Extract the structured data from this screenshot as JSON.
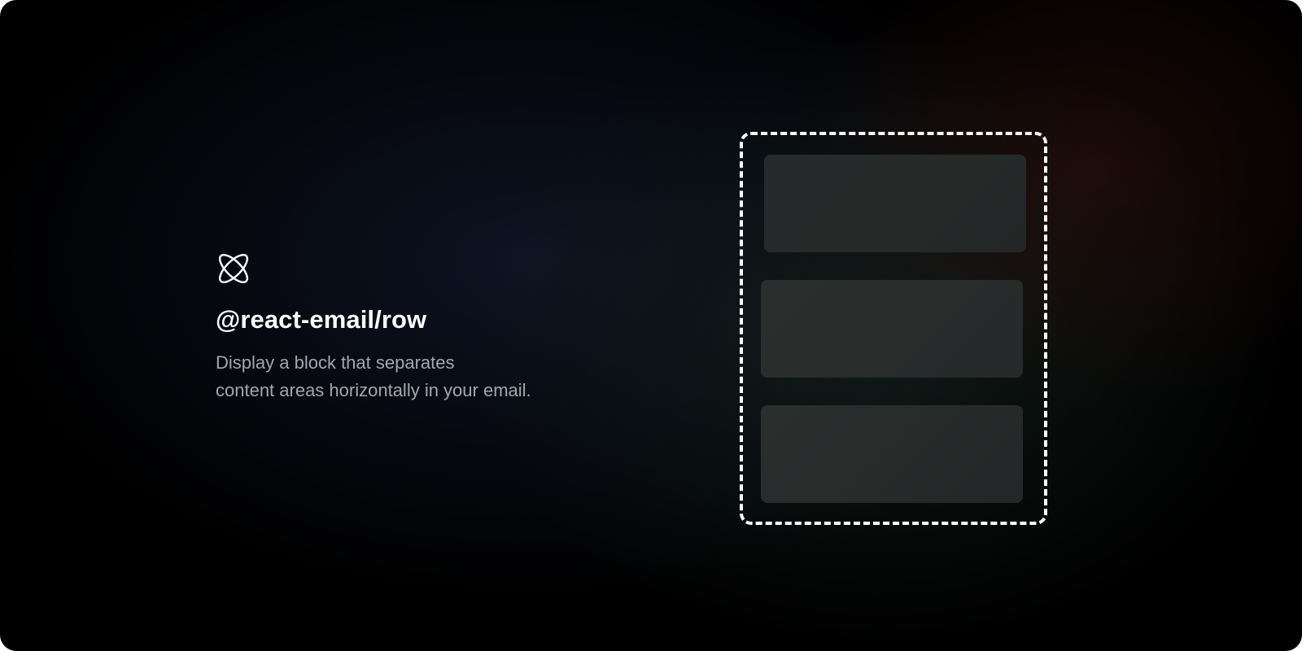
{
  "hero": {
    "icon": "react-atom-icon",
    "title": "@react-email/row",
    "description_line1": "Display a block that separates",
    "description_line2": "content areas horizontally in your email."
  },
  "illustration": {
    "frame_style": "dashed",
    "row_count": 3
  },
  "colors": {
    "background": "#000000",
    "title": "#ffffff",
    "description": "#a3a7ad",
    "frame_border": "#ffffff",
    "row_block": "#282c2b"
  }
}
